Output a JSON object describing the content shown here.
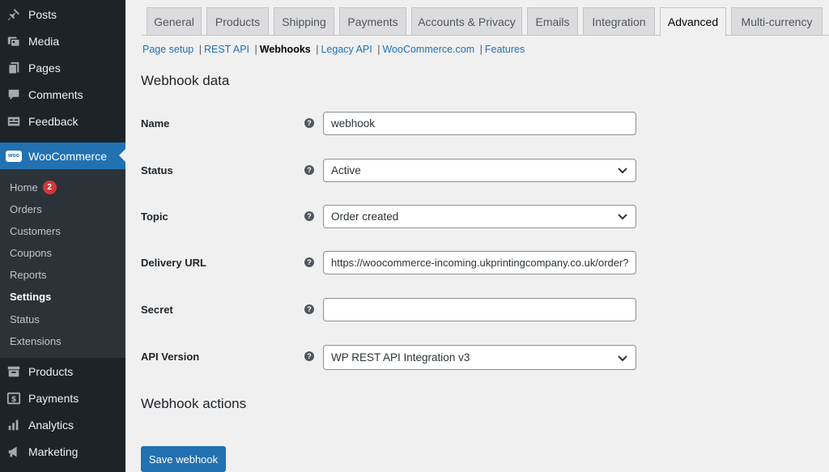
{
  "sidebar": {
    "items_top": [
      {
        "label": "Posts",
        "icon": "pushpin-icon"
      },
      {
        "label": "Media",
        "icon": "media-icon"
      },
      {
        "label": "Pages",
        "icon": "pages-icon"
      },
      {
        "label": "Comments",
        "icon": "comment-icon"
      },
      {
        "label": "Feedback",
        "icon": "feedback-icon"
      }
    ],
    "woocommerce": {
      "label": "WooCommerce",
      "icon": "woo-icon",
      "logo_text": "woo"
    },
    "submenu": [
      {
        "label": "Home",
        "badge": "2"
      },
      {
        "label": "Orders"
      },
      {
        "label": "Customers"
      },
      {
        "label": "Coupons"
      },
      {
        "label": "Reports"
      },
      {
        "label": "Settings"
      },
      {
        "label": "Status"
      },
      {
        "label": "Extensions"
      }
    ],
    "items_bottom": [
      {
        "label": "Products",
        "icon": "archive-icon"
      },
      {
        "label": "Payments",
        "icon": "dollar-icon"
      },
      {
        "label": "Analytics",
        "icon": "bar-chart-icon"
      },
      {
        "label": "Marketing",
        "icon": "megaphone-icon"
      }
    ],
    "colors": {
      "background": "#1d2327",
      "submenu_bg": "#2c3338",
      "current_bg": "#2271b1",
      "badge": "#d63638"
    }
  },
  "tabs": [
    {
      "label": "General"
    },
    {
      "label": "Products"
    },
    {
      "label": "Shipping"
    },
    {
      "label": "Payments"
    },
    {
      "label": "Accounts & Privacy"
    },
    {
      "label": "Emails"
    },
    {
      "label": "Integration"
    },
    {
      "label": "Advanced",
      "active": true
    },
    {
      "label": "Multi-currency"
    }
  ],
  "subnav": [
    {
      "label": "Page setup"
    },
    {
      "label": "REST API"
    },
    {
      "label": "Webhooks",
      "current": true
    },
    {
      "label": "Legacy API"
    },
    {
      "label": "WooCommerce.com"
    },
    {
      "label": "Features"
    }
  ],
  "subnav_separator": "|",
  "webhook_data": {
    "title": "Webhook data",
    "fields": [
      {
        "label": "Name",
        "type": "text",
        "value": "webhook"
      },
      {
        "label": "Status",
        "type": "select",
        "value": "Active"
      },
      {
        "label": "Topic",
        "type": "select",
        "value": "Order created"
      },
      {
        "label": "Delivery URL",
        "type": "text",
        "value": "https://woocommerce-incoming.ukprintingcompany.co.uk/order?"
      },
      {
        "label": "Secret",
        "type": "text",
        "value": ""
      },
      {
        "label": "API Version",
        "type": "select",
        "value": "WP REST API Integration v3"
      }
    ],
    "help_glyph": "?"
  },
  "webhook_actions": {
    "title": "Webhook actions"
  },
  "save_button": {
    "label": "Save webhook"
  },
  "accent_color": "#2271b1"
}
